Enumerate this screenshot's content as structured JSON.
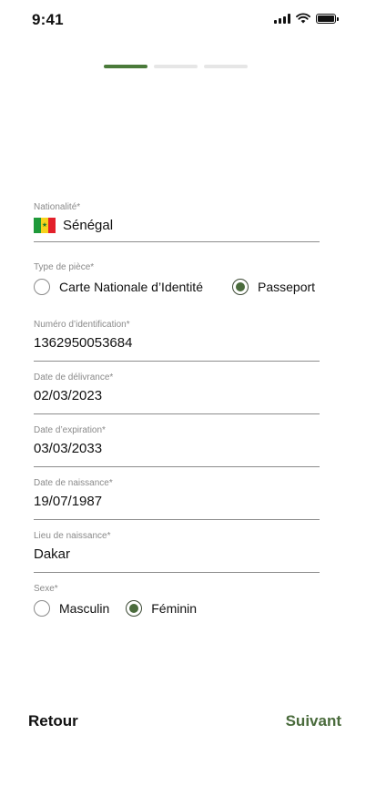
{
  "status_bar": {
    "time": "9:41"
  },
  "progress": {
    "total_steps": 3,
    "current_step": 1
  },
  "form": {
    "nationality": {
      "label": "Nationalité*",
      "value": "Sénégal",
      "flag_icon": "senegal-flag-icon"
    },
    "id_type": {
      "label": "Type de pièce*",
      "options": [
        "Carte Nationale d’Identité",
        "Passeport"
      ],
      "selected": "Passeport"
    },
    "id_number": {
      "label": "Numéro d’identification*",
      "value": "1362950053684"
    },
    "issue_date": {
      "label": "Date de délivrance*",
      "value": "02/03/2023"
    },
    "expiry_date": {
      "label": "Date d’expiration*",
      "value": "03/03/2033"
    },
    "birth_date": {
      "label": "Date de naissance*",
      "value": "19/07/1987"
    },
    "birth_place": {
      "label": "Lieu de naissance*",
      "value": "Dakar"
    },
    "sex": {
      "label": "Sexe*",
      "options": [
        "Masculin",
        "Féminin"
      ],
      "selected": "Féminin"
    }
  },
  "footer": {
    "back_label": "Retour",
    "next_label": "Suivant"
  },
  "colors": {
    "accent": "#4a6b3c",
    "progress_active": "#4a7a3a",
    "progress_inactive": "#e6e6e6"
  }
}
